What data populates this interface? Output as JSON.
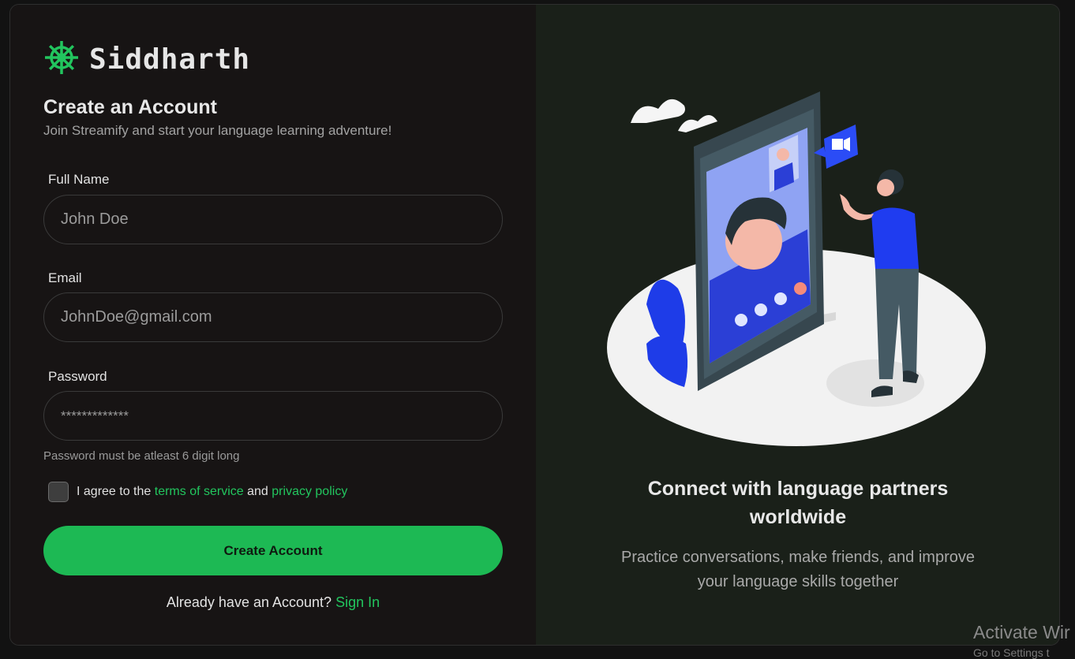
{
  "brand": {
    "name": "Siddharth",
    "icon": "ship-wheel-icon",
    "accent": "#22c55e"
  },
  "form": {
    "title": "Create an Account",
    "subtitle": "Join Streamify and start your language learning adventure!",
    "full_name": {
      "label": "Full Name",
      "placeholder": "John Doe"
    },
    "email": {
      "label": "Email",
      "placeholder": "JohnDoe@gmail.com"
    },
    "password": {
      "label": "Password",
      "placeholder": "*************",
      "hint": "Password must be atleast 6 digit long"
    },
    "agree": {
      "prefix": "I agree to the",
      "terms": "terms of service",
      "and": "and",
      "privacy": "privacy policy"
    },
    "submit_label": "Create Account",
    "signin": {
      "prompt": "Already have an Account?",
      "link": "Sign In"
    }
  },
  "promo": {
    "headline_line1": "Connect with language partners",
    "headline_line2": "worldwide",
    "desc_line1": "Practice conversations, make friends, and improve",
    "desc_line2": "your language skills together"
  },
  "watermark": {
    "title": "Activate Wir",
    "sub": "Go to Settings t"
  }
}
